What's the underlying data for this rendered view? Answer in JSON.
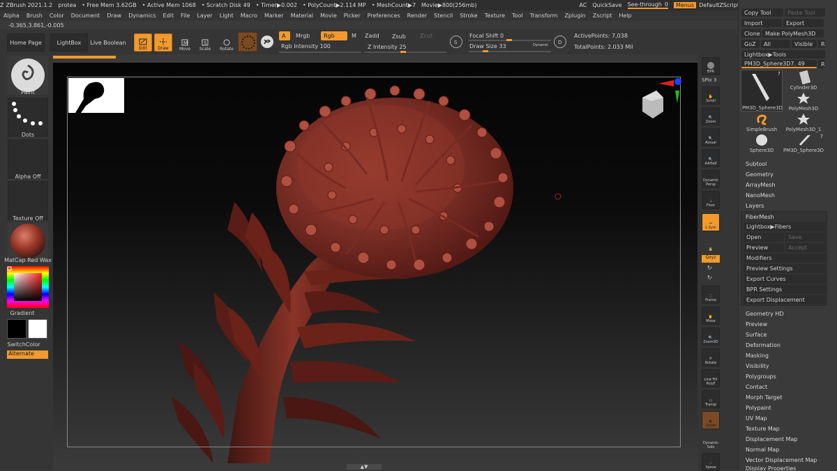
{
  "title_bar": {
    "app": "ZBrush 2021.1.2",
    "project": "protea",
    "free_mem": "• Free Mem 3.62GB",
    "active_mem": "• Active Mem 1068",
    "scratch": "• Scratch Disk 49",
    "timer": "• Timer▶0.002",
    "polycount": "• PolyCount▶2.114 MP",
    "meshcount": "• MeshCount▶7",
    "movie": "Movie▶800(256mb)",
    "ac": "AC",
    "quicksave": "QuickSave",
    "see_through": "See-through",
    "see_through_value": "0",
    "menus": "Menus",
    "script": "DefaultZScript"
  },
  "menu_bar": [
    "Alpha",
    "Brush",
    "Color",
    "Document",
    "Draw",
    "Dynamics",
    "Edit",
    "File",
    "Layer",
    "Light",
    "Macro",
    "Marker",
    "Material",
    "Movie",
    "Picker",
    "Preferences",
    "Render",
    "Stencil",
    "Stroke",
    "Texture",
    "Tool",
    "Transform",
    "Zplugin",
    "Zscript",
    "Help"
  ],
  "coords": "-0.365,3.861,-0.005",
  "toolbar": {
    "home_page": "Home Page",
    "lightbox": "LightBox",
    "live_boolean": "Live Boolean",
    "edit": "Edit",
    "draw": "Draw",
    "move": "Move",
    "scale": "Scale",
    "rotate": "Rotate",
    "a": "A",
    "mrgb": "Mrgb",
    "rgb": "Rgb",
    "m": "M",
    "rgb_intensity_label": "Rgb Intensity",
    "rgb_intensity_value": "100",
    "zadd": "Zadd",
    "zsub": "Zsub",
    "zcut": "Zcut",
    "z_intensity_label": "Z Intensity",
    "z_intensity_value": "25",
    "focal_shift_label": "Focal Shift",
    "focal_shift_value": "0",
    "draw_size_label": "Draw Size",
    "draw_size_value": "33",
    "dynamic": "Dynamic",
    "active_points": "ActivePoints: 7,038",
    "total_points": "TotalPoints: 2.033 Mil",
    "s_label": "S",
    "d_label": "D"
  },
  "left_shelf": {
    "paint": "Paint",
    "dots": "Dots",
    "alpha_off": "Alpha Off",
    "texture_off": "Texture Off",
    "material": "MatCap Red Wax",
    "gradient": "Gradient",
    "switch_color": "SwitchColor",
    "alternate": "Alternate"
  },
  "right_shelf": {
    "bpr": "BPR",
    "spix": "SPix 3",
    "scroll": "Scroll",
    "zoom": "Zoom",
    "actual": "Actual",
    "aahalf": "AAHalf",
    "dynamic": "Dynamic",
    "persp": "Persp",
    "floor": "Floor",
    "lsym": "L.Sym",
    "xyz": "Qxyz",
    "frame": "Frame",
    "move": "Move",
    "zoom3d": "Zoom3D",
    "rotate": "Rotate",
    "line_fill": "Line Fill",
    "polyf": "PolyF",
    "transp": "Transp",
    "ghost": "Ghost",
    "solo": "Solo",
    "xpose": "Xpose"
  },
  "right_panel": {
    "copy_tool": "Copy Tool",
    "paste_tool": "Paste Tool",
    "import": "Import",
    "export": "Export",
    "clone": "Clone",
    "make_polymesh": "Make PolyMesh3D",
    "goz": "GoZ",
    "all": "All",
    "visible": "Visible",
    "r": "R",
    "lightbox_tools": "Lightbox▶Tools",
    "current_tool": "PM3D_Sphere3D7. 49",
    "tools": [
      {
        "name": "PM3D_Sphere3D",
        "count": "7"
      },
      {
        "name": "Cylinder3D",
        "count": ""
      },
      {
        "name": "",
        "count": ""
      },
      {
        "name": "PolyMesh3D",
        "count": ""
      },
      {
        "name": "SimpleBrush",
        "count": ""
      },
      {
        "name": "PolyMesh3D_1",
        "count": ""
      },
      {
        "name": "Sphere3D",
        "count": ""
      },
      {
        "name": "PM3D_Sphere3D",
        "count": "7"
      }
    ],
    "sections_top": [
      "Subtool",
      "Geometry",
      "ArrayMesh",
      "NanoMesh",
      "Layers",
      "FiberMesh"
    ],
    "fibermesh_items": [
      "Lightbox▶Fibers",
      "Open",
      "Save",
      "Preview",
      "Accept",
      "Modifiers",
      "Preview Settings",
      "Export Curves",
      "BPR Settings",
      "Export Displacement"
    ],
    "sections_bottom": [
      "Geometry HD",
      "Preview",
      "Surface",
      "Deformation",
      "Masking",
      "Visibility",
      "Polygroups",
      "Contact",
      "Morph Target",
      "Polypaint",
      "UV Map",
      "Texture Map",
      "Displacement Map",
      "Normal Map",
      "Vector Displacement Map",
      "Display Properties"
    ]
  },
  "colors": {
    "accent": "#f29a2e",
    "panel": "#353535",
    "clay": "#7a2a22"
  }
}
